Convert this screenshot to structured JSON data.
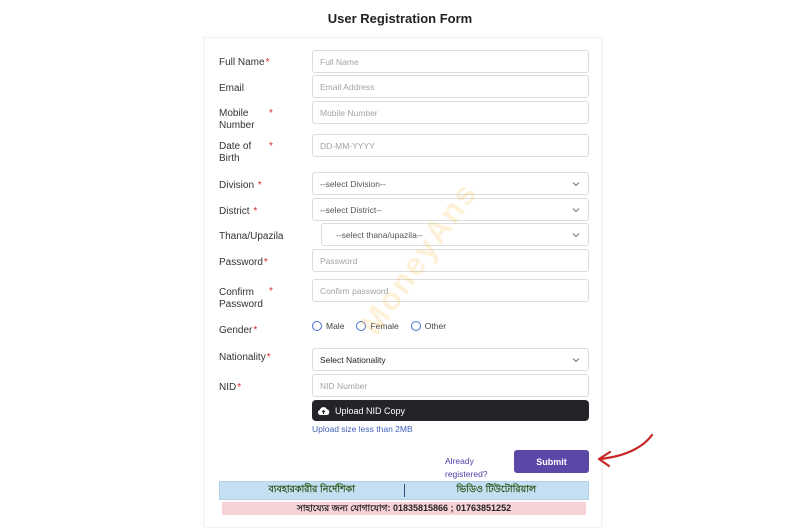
{
  "title": "User Registration Form",
  "fields": {
    "full_name": {
      "label": "Full Name",
      "required": "*",
      "placeholder": "Full Name"
    },
    "email": {
      "label": "Email",
      "placeholder": "Email Address"
    },
    "mobile": {
      "label_line1": "Mobile",
      "label_line2": "Number",
      "required": "*",
      "placeholder": "Mobile Number"
    },
    "dob": {
      "label_line1": "Date of",
      "label_line2": "Birth",
      "required": "*",
      "placeholder": "DD-MM-YYYY"
    },
    "division": {
      "label": "Division",
      "required": "*",
      "value": "--select Division--"
    },
    "district": {
      "label": "District",
      "required": "*",
      "value": "--select District--"
    },
    "thana": {
      "label": "Thana/Upazila",
      "value": "--select thana/upazila--"
    },
    "password": {
      "label": "Password",
      "required": "*",
      "placeholder": "Password"
    },
    "confirm_password": {
      "label_line1": "Confirm",
      "label_line2": "Password",
      "required": "*",
      "placeholder": "Confirm password"
    },
    "gender": {
      "label": "Gender",
      "required": "*",
      "options": [
        "Male",
        "Female",
        "Other"
      ]
    },
    "nationality": {
      "label": "Nationality",
      "required": "*",
      "value": "Select Nationality"
    },
    "nid": {
      "label": "NID",
      "required": "*",
      "placeholder": "NID Number"
    }
  },
  "upload": {
    "label": "Upload NID Copy",
    "icon": "cloud-upload-icon",
    "hint": "Upload size less than 2MB"
  },
  "already_registered": {
    "line1": "Already",
    "line2": "registered?"
  },
  "submit_label": "Submit",
  "guide": {
    "user_guide": "ব্যবহারকারীর নির্দেশিকা",
    "video_tutorial": "ভিডিও টিউটোরিয়াল"
  },
  "help_text": "সাহায্যের জন্য যোগাযোগ: 01835815866 ; 01763851252",
  "watermark": "MoneyAns",
  "colors": {
    "submit": "#5b47a8",
    "required": "#d9262b",
    "upload": "#222427",
    "arrow": "#c62828"
  }
}
